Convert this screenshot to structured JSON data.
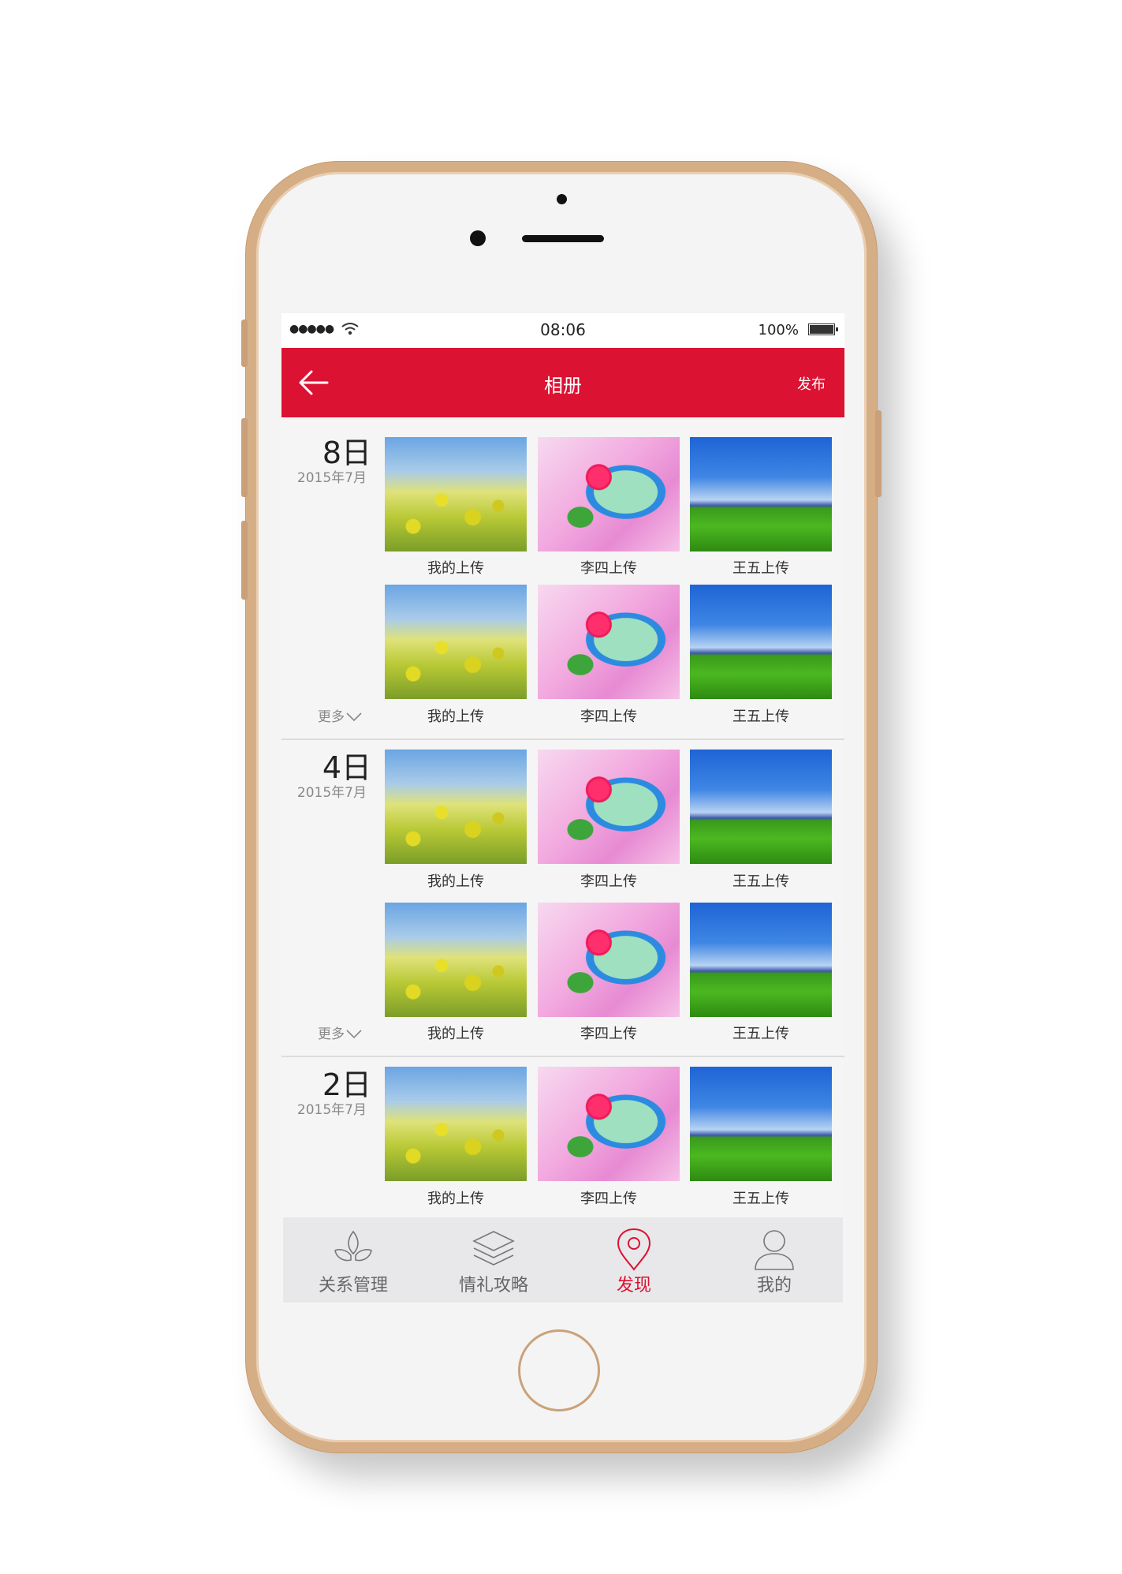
{
  "status_bar": {
    "signal": "●●●●●",
    "time": "08:06",
    "battery": "100%"
  },
  "navbar": {
    "title": "相册",
    "action": "发布"
  },
  "sections": [
    {
      "day": "8日",
      "month": "2015年7月",
      "more": "更多",
      "photos": [
        {
          "caption": "我的上传"
        },
        {
          "caption": "李四上传"
        },
        {
          "caption": "王五上传"
        },
        {
          "caption": "我的上传"
        },
        {
          "caption": "李四上传"
        },
        {
          "caption": "王五上传"
        }
      ]
    },
    {
      "day": "4日",
      "month": "2015年7月",
      "more": "更多",
      "photos": [
        {
          "caption": "我的上传"
        },
        {
          "caption": "李四上传"
        },
        {
          "caption": "王五上传"
        },
        {
          "caption": "我的上传"
        },
        {
          "caption": "李四上传"
        },
        {
          "caption": "王五上传"
        }
      ]
    },
    {
      "day": "2日",
      "month": "2015年7月",
      "photos": [
        {
          "caption": "我的上传"
        },
        {
          "caption": "李四上传"
        },
        {
          "caption": "王五上传"
        }
      ]
    }
  ],
  "tabbar": {
    "items": [
      {
        "label": "关系管理",
        "icon": "leaves-icon"
      },
      {
        "label": "情礼攻略",
        "icon": "layers-icon"
      },
      {
        "label": "发现",
        "icon": "location-pin-icon",
        "active": true
      },
      {
        "label": "我的",
        "icon": "person-icon"
      }
    ]
  },
  "colors": {
    "accent": "#dc1232",
    "phone_frame": "#d6ae86"
  }
}
